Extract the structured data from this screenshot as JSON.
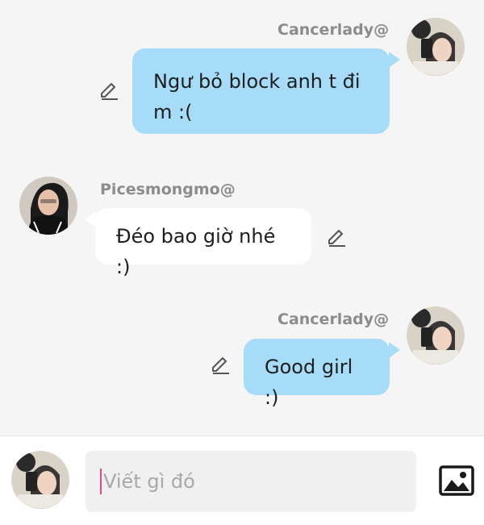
{
  "messages": [
    {
      "sender": "Cancerlady@",
      "text_lines": [
        "Ngư bỏ block anh t đi",
        "m :("
      ],
      "direction": "outgoing"
    },
    {
      "sender": "Picesmongmo@",
      "text_lines": [
        "Đéo bao giờ nhé :)"
      ],
      "direction": "incoming"
    },
    {
      "sender": "Cancerlady@",
      "text_lines": [
        "Good girl :)"
      ],
      "direction": "outgoing"
    }
  ],
  "composer": {
    "placeholder": "Viết gì đó"
  },
  "colors": {
    "outgoing_bubble": "#a6dcf8",
    "incoming_bubble": "#ffffff",
    "background": "#f5f5f5",
    "username": "#8c8c8c",
    "caret": "#e0468a"
  },
  "icons": {
    "edit": "pencil-icon",
    "attach_image": "image-icon"
  }
}
